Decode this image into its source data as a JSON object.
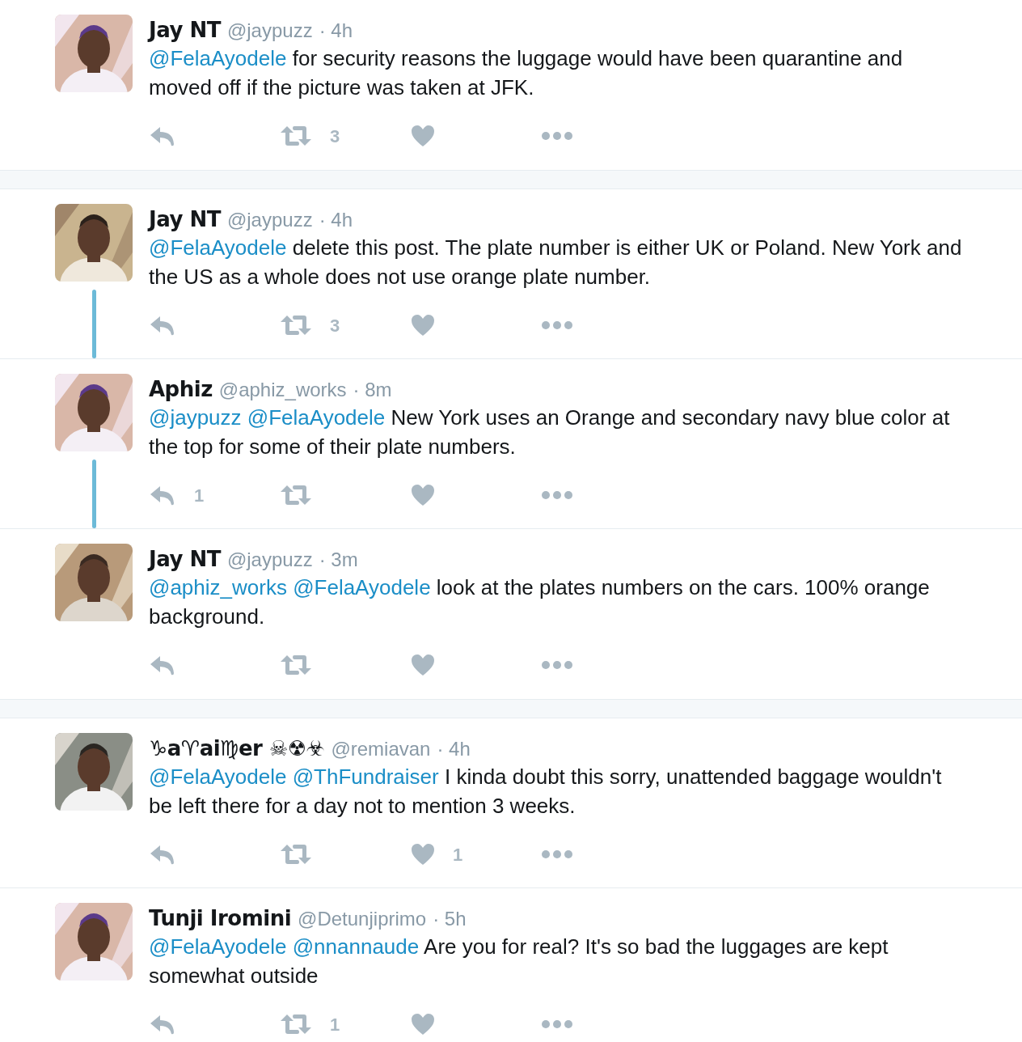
{
  "conversations": [
    {
      "tweets": [
        {
          "name": "Jay NT",
          "handle": "@jaypuzz",
          "time": "· 4h",
          "avatar": {
            "kind": "picture"
          },
          "mentions": [
            "@FelaAyodele"
          ],
          "text": "for security reasons the luggage would have been quarantine and moved off if the picture was taken at JFK.",
          "retweets": "3"
        }
      ]
    },
    {
      "threaded": true,
      "tweets": [
        {
          "name": "Jay NT",
          "handle": "@jaypuzz",
          "time": "· 4h",
          "avatar": {
            "kind": "picture"
          },
          "mentions": [
            "@FelaAyodele"
          ],
          "text": "delete this post. The plate number is either UK or Poland. New York and the US as a whole does not use orange plate number.",
          "retweets": "3"
        },
        {
          "name": "Aphiz",
          "handle": "@aphiz_works",
          "time": "· 8m",
          "avatar": {
            "kind": "picture"
          },
          "mentions": [
            "@jaypuzz",
            "@FelaAyodele"
          ],
          "text": "New York uses an Orange and secondary navy blue color at the top for some of their plate numbers.",
          "replies": "1"
        },
        {
          "name": "Jay NT",
          "handle": "@jaypuzz",
          "time": "· 3m",
          "avatar": {
            "kind": "picture"
          },
          "mentions": [
            "@aphiz_works",
            "@FelaAyodele"
          ],
          "text": "look at the plates numbers on the cars. 100% orange background."
        }
      ]
    },
    {
      "tweets": [
        {
          "name": "♑a♈ai♍er ☠☢☣",
          "handle": "@remiavan",
          "time": "· 4h",
          "avatar": {
            "kind": "picture"
          },
          "mentions": [
            "@FelaAyodele",
            "@ThFundraiser"
          ],
          "text": "I kinda doubt this sorry, unattended baggage wouldn't be left there for a day not to mention 3 weeks.",
          "likes": "1"
        },
        {
          "name": "Tunji Iromini",
          "handle": "@Detunjiprimo",
          "time": "· 5h",
          "avatar": {
            "kind": "picture"
          },
          "mentions": [
            "@FelaAyodele",
            "@nnannaude"
          ],
          "text": "Are you for real? It's so bad the luggages are kept somewhat outside",
          "retweets": "1"
        }
      ]
    }
  ]
}
